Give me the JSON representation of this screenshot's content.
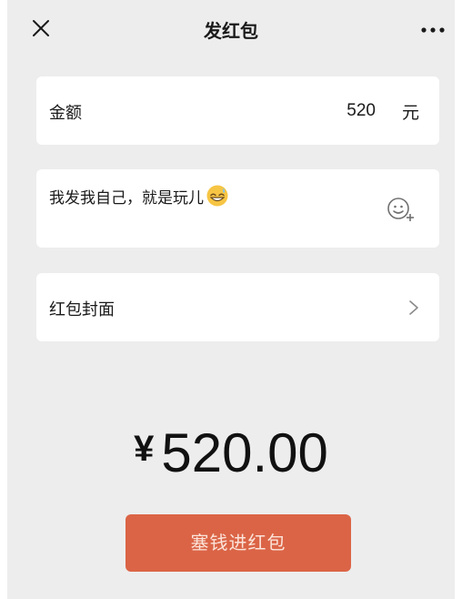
{
  "nav": {
    "title": "发红包"
  },
  "amount": {
    "label": "金额",
    "value": "520",
    "unit": "元"
  },
  "blessing": {
    "text": "我发我自己，就是玩儿",
    "emoji": "grinning-sweat-emoji"
  },
  "cover": {
    "label": "红包封面"
  },
  "total": {
    "currency": "¥",
    "value": "520.00"
  },
  "submit": {
    "label": "塞钱进红包"
  },
  "colors": {
    "background": "#ededed",
    "card": "#ffffff",
    "button": "#db6446",
    "button_text": "#fbe3d9"
  }
}
